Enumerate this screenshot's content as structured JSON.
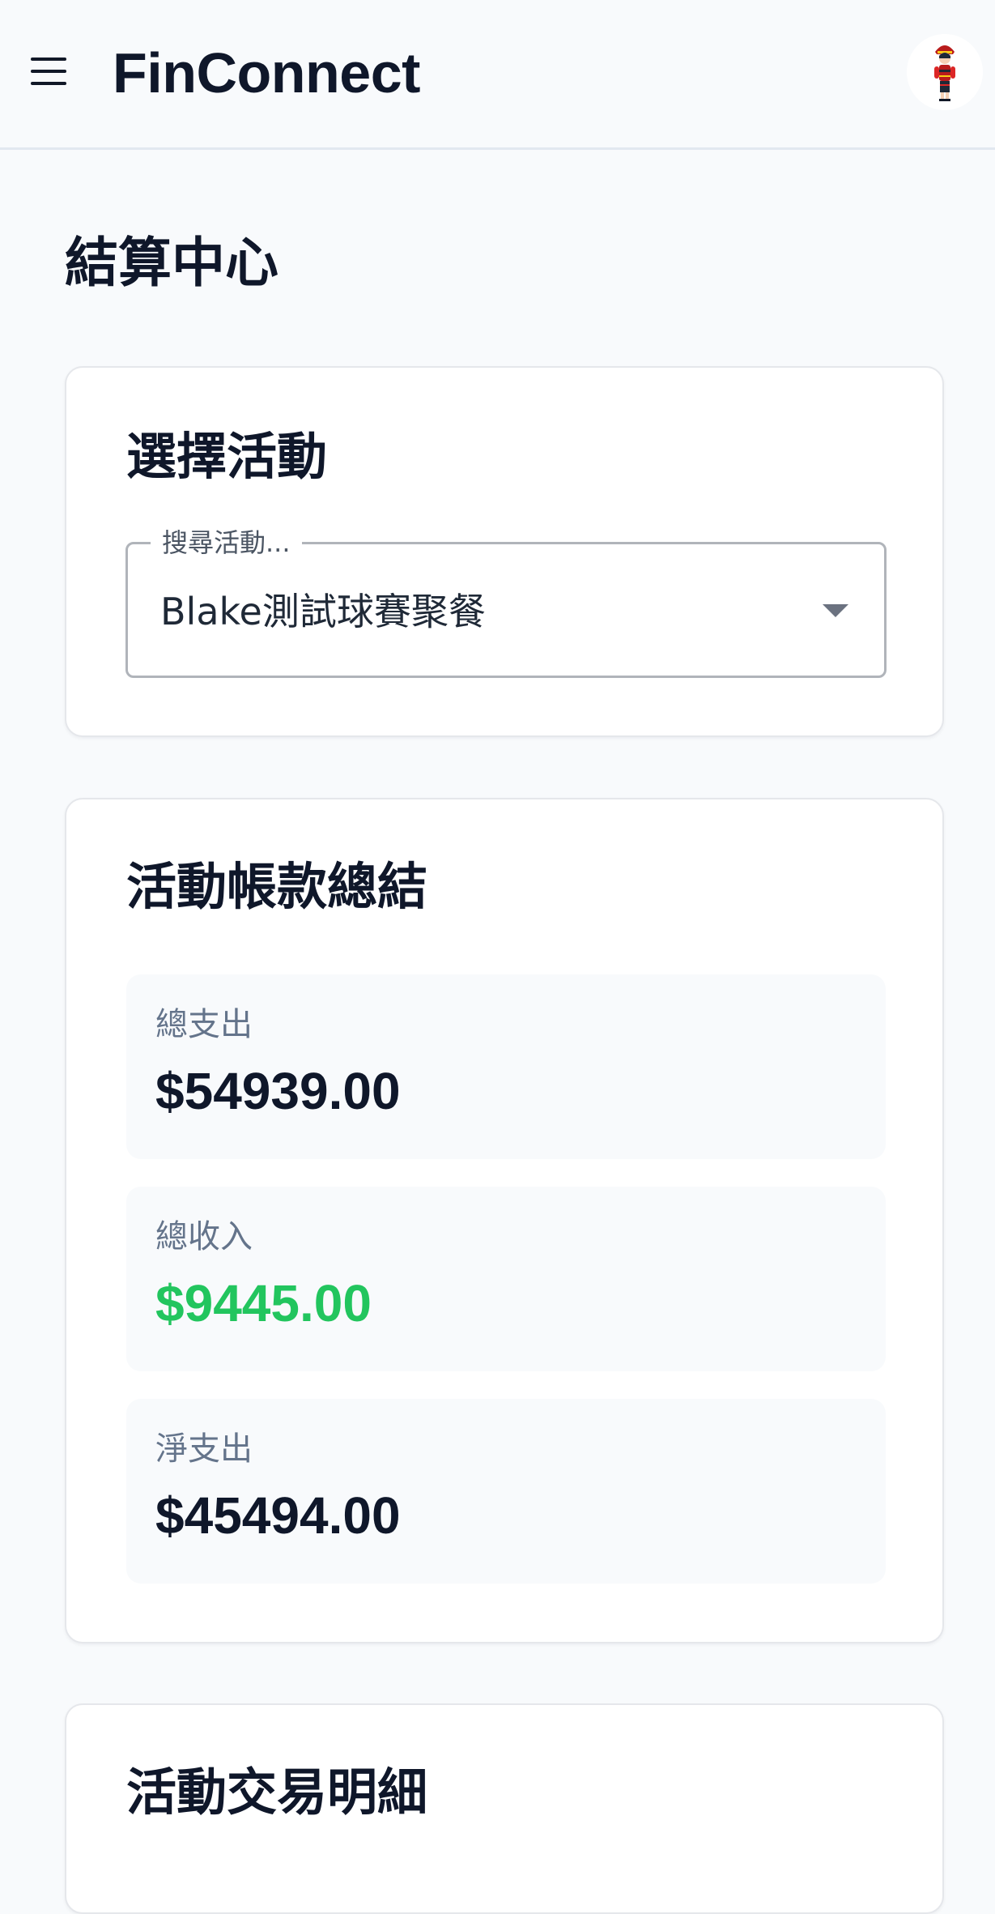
{
  "app": {
    "title": "FinConnect"
  },
  "icons": {
    "menu": "menu-icon",
    "avatar": "user-avatar",
    "dropdown": "caret-down-icon"
  },
  "page": {
    "title": "結算中心"
  },
  "select_activity": {
    "title": "選擇活動",
    "search_label": "搜尋活動...",
    "selected_value": "Blake測試球賽聚餐"
  },
  "summary": {
    "title": "活動帳款總結",
    "total_expense": {
      "label": "總支出",
      "value": "$54939.00"
    },
    "total_income": {
      "label": "總收入",
      "value": "$9445.00"
    },
    "net_expense": {
      "label": "淨支出",
      "value": "$45494.00"
    }
  },
  "transactions": {
    "title": "活動交易明細"
  },
  "colors": {
    "background": "#f8fafc",
    "card": "#ffffff",
    "text_primary": "#0f172a",
    "text_muted": "#64748b",
    "income_green": "#22c55e"
  }
}
